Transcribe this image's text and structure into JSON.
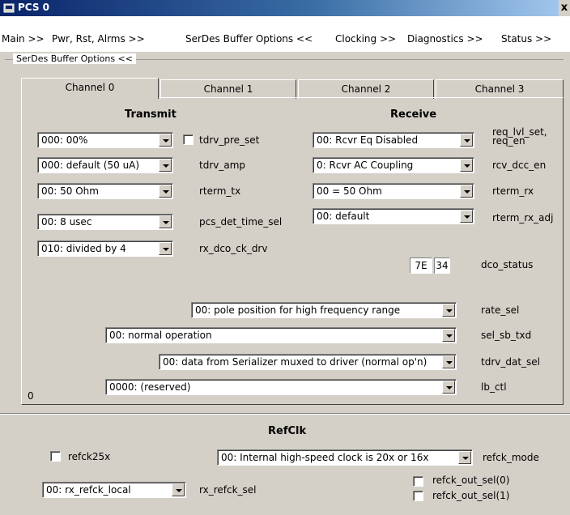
{
  "window": {
    "title": "PCS 0",
    "close": "x"
  },
  "menu": {
    "items": [
      "Main >>",
      "Pwr, Rst, Alrms >>",
      "SerDes Buffer Options <<",
      "Clocking >>",
      "Diagnostics >>",
      "Status >>"
    ],
    "subsection": "SerDes Buffer Options  <<"
  },
  "tabs": [
    "Channel 0",
    "Channel 1",
    "Channel 2",
    "Channel 3"
  ],
  "transmit": {
    "heading": "Transmit",
    "tdrv_pre_set_value": "000:  00%",
    "tdrv_pre_set_label": "tdrv_pre_set",
    "tdrv_amp_value": "000:  default (50 uA)",
    "tdrv_amp_label": "tdrv_amp",
    "rterm_tx_value": "00:  50 Ohm",
    "rterm_tx_label": "rterm_tx",
    "pcs_det_time_sel_value": "00:   8 usec",
    "pcs_det_time_sel_label": "pcs_det_time_sel",
    "rx_dco_ck_drv_value": "010:  divided by 4",
    "rx_dco_ck_drv_label": "rx_dco_ck_drv"
  },
  "receive": {
    "heading": "Receive",
    "req_value": "00: Rcvr Eq Disabled",
    "req_label_1": "req_lvl_set,",
    "req_label_2": "req_en",
    "rcv_dcc_en_value": "0:  Rcvr AC Coupling",
    "rcv_dcc_en_label": "rcv_dcc_en",
    "rterm_rx_value": "00 = 50 Ohm",
    "rterm_rx_label": "rterm_rx",
    "rterm_rx_adj_value": "00:  default",
    "rterm_rx_adj_label": "rterm_rx_adj",
    "dco_status_1": "7E",
    "dco_status_2": "34",
    "dco_status_label": "dco_status"
  },
  "rows": {
    "rate_sel_value": "00:   pole position for high frequency range",
    "rate_sel_label": "rate_sel",
    "sel_sb_txd_value": "00:   normal operation",
    "sel_sb_txd_label": "sel_sb_txd",
    "tdrv_dat_sel_value": "00:   data from Serializer muxed to driver (normal op'n)",
    "tdrv_dat_sel_label": "tdrv_dat_sel",
    "lb_ctl_value": "0000:  (reserved)",
    "lb_ctl_label": "lb_ctl",
    "channel_index": "0"
  },
  "refclk": {
    "heading": "RefClk",
    "refck25x_label": "refck25x",
    "refck_mode_value": "00:   Internal high-speed clock is 20x or 16x",
    "refck_mode_label": "refck_mode",
    "rx_refck_sel_value": "00:  rx_refck_local",
    "rx_refck_sel_label": "rx_refck_sel",
    "refck_out_sel0_label": "refck_out_sel(0)",
    "refck_out_sel1_label": "refck_out_sel(1)"
  }
}
